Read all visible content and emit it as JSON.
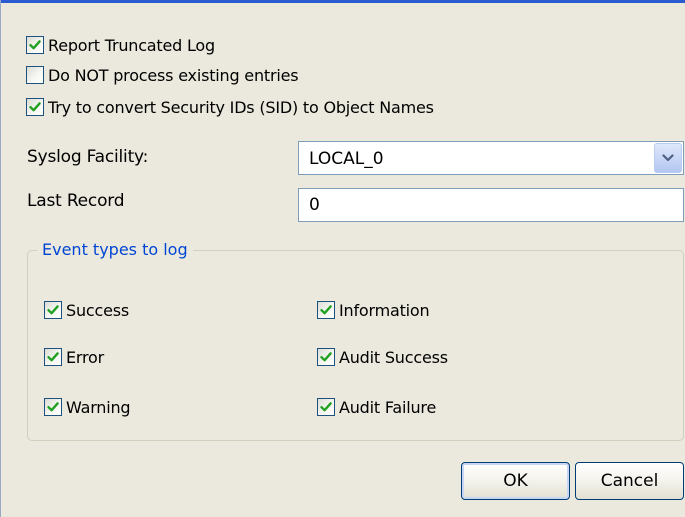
{
  "options": {
    "report_truncated_log": {
      "label": "Report Truncated Log",
      "checked": true
    },
    "do_not_process_existing": {
      "label": "Do NOT process existing entries",
      "checked": false
    },
    "convert_sid": {
      "label": "Try to convert Security IDs (SID) to Object Names",
      "checked": true
    }
  },
  "syslog_facility": {
    "label": "Syslog Facility:",
    "value": "LOCAL_0"
  },
  "last_record": {
    "label": "Last Record",
    "value": "0"
  },
  "event_types": {
    "legend": "Event types to log",
    "success": {
      "label": "Success",
      "checked": true
    },
    "error": {
      "label": "Error",
      "checked": true
    },
    "warning": {
      "label": "Warning",
      "checked": true
    },
    "information": {
      "label": "Information",
      "checked": true
    },
    "audit_success": {
      "label": "Audit Success",
      "checked": true
    },
    "audit_failure": {
      "label": "Audit Failure",
      "checked": true
    }
  },
  "buttons": {
    "ok": "OK",
    "cancel": "Cancel"
  },
  "colors": {
    "dialog_background": "#ebe9dd",
    "title_bar_edge": "#2a5bd0",
    "group_legend_text": "#0046d5",
    "checkmark": "#21a121",
    "input_border": "#7f9db9",
    "button_border": "#003c74"
  },
  "icons": {
    "checkbox_checked": "checkmark-icon",
    "dropdown": "chevron-down-icon"
  }
}
